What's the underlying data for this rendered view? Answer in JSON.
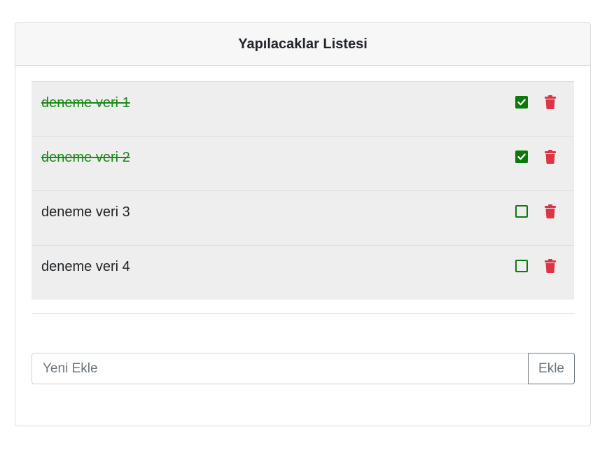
{
  "header": {
    "title": "Yapılacaklar Listesi"
  },
  "todos": [
    {
      "text": "deneme veri 1",
      "done": true
    },
    {
      "text": "deneme veri 2",
      "done": true
    },
    {
      "text": "deneme veri 3",
      "done": false
    },
    {
      "text": "deneme veri 4",
      "done": false
    }
  ],
  "add_form": {
    "placeholder": "Yeni Ekle",
    "button_label": "Ekle"
  },
  "colors": {
    "done_text": "#1a8a1a",
    "checkbox": "#0b7a0b",
    "trash": "#dc3545",
    "list_bg": "#eeeeee"
  },
  "icons": {
    "check": "check-icon",
    "delete": "trash-icon"
  }
}
